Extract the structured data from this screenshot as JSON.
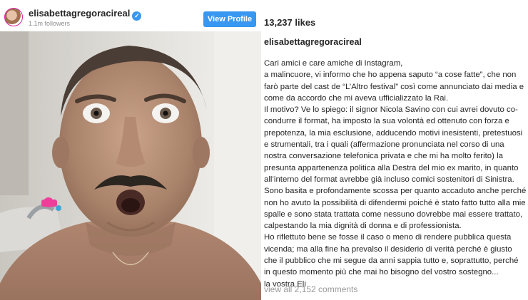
{
  "header": {
    "username": "elisabettagregoracireal",
    "followers": "1.1m followers",
    "view_profile_label": "View Profile"
  },
  "colors": {
    "accent": "#3897f0",
    "muted": "#8e8e8e"
  },
  "icons": {
    "verified": "verified-badge-icon"
  },
  "post": {
    "likes": "13,237 likes",
    "caption_username": "elisabettagregoracireal",
    "caption_lines": [
      "Cari amici e care amiche di Instagram,",
      "a malincuore, vi informo che ho appena saputo “a cose fatte”, che non farò parte del cast de “L’Altro festival” così come annunciato dai media e come da accordo che mi aveva ufficializzato la Rai.",
      "Il motivo? Ve lo spiego: il signor Nicola Savino con cui avrei dovuto co-condurre il format, ha imposto la sua volontà ed ottenuto con forza e prepotenza, la mia esclusione, adducendo motivi inesistenti, pretestuosi e strumentali, tra i quali (affermazione pronunciata nel corso di una nostra conversazione telefonica privata e che mi ha molto ferito) la presunta appartenenza politica alla Destra del mio ex marito, in quanto all’interno del format avrebbe già incluso comici sostenitori di Sinistra.",
      "Sono basita e profondamente scossa per quanto accaduto anche perché non ho avuto la possibilità di difendermi poiché è stato fatto tutto alla mie spalle e sono stata trattata come nessuno dovrebbe mai essere trattato, calpestando la mia dignità di donna e di professionista.",
      "Ho riflettuto bene se fosse il caso o meno di rendere pubblica questa vicenda; ma alla fine ha prevalso il desiderio di verità perché è giusto che il pubblico che mi segue da anni sappia tutto e, soprattutto, perché in questo momento più che mai ho bisogno del vostro sostegno...",
      "la vostra Eli"
    ],
    "view_comments": "view all 2,152 comments"
  }
}
